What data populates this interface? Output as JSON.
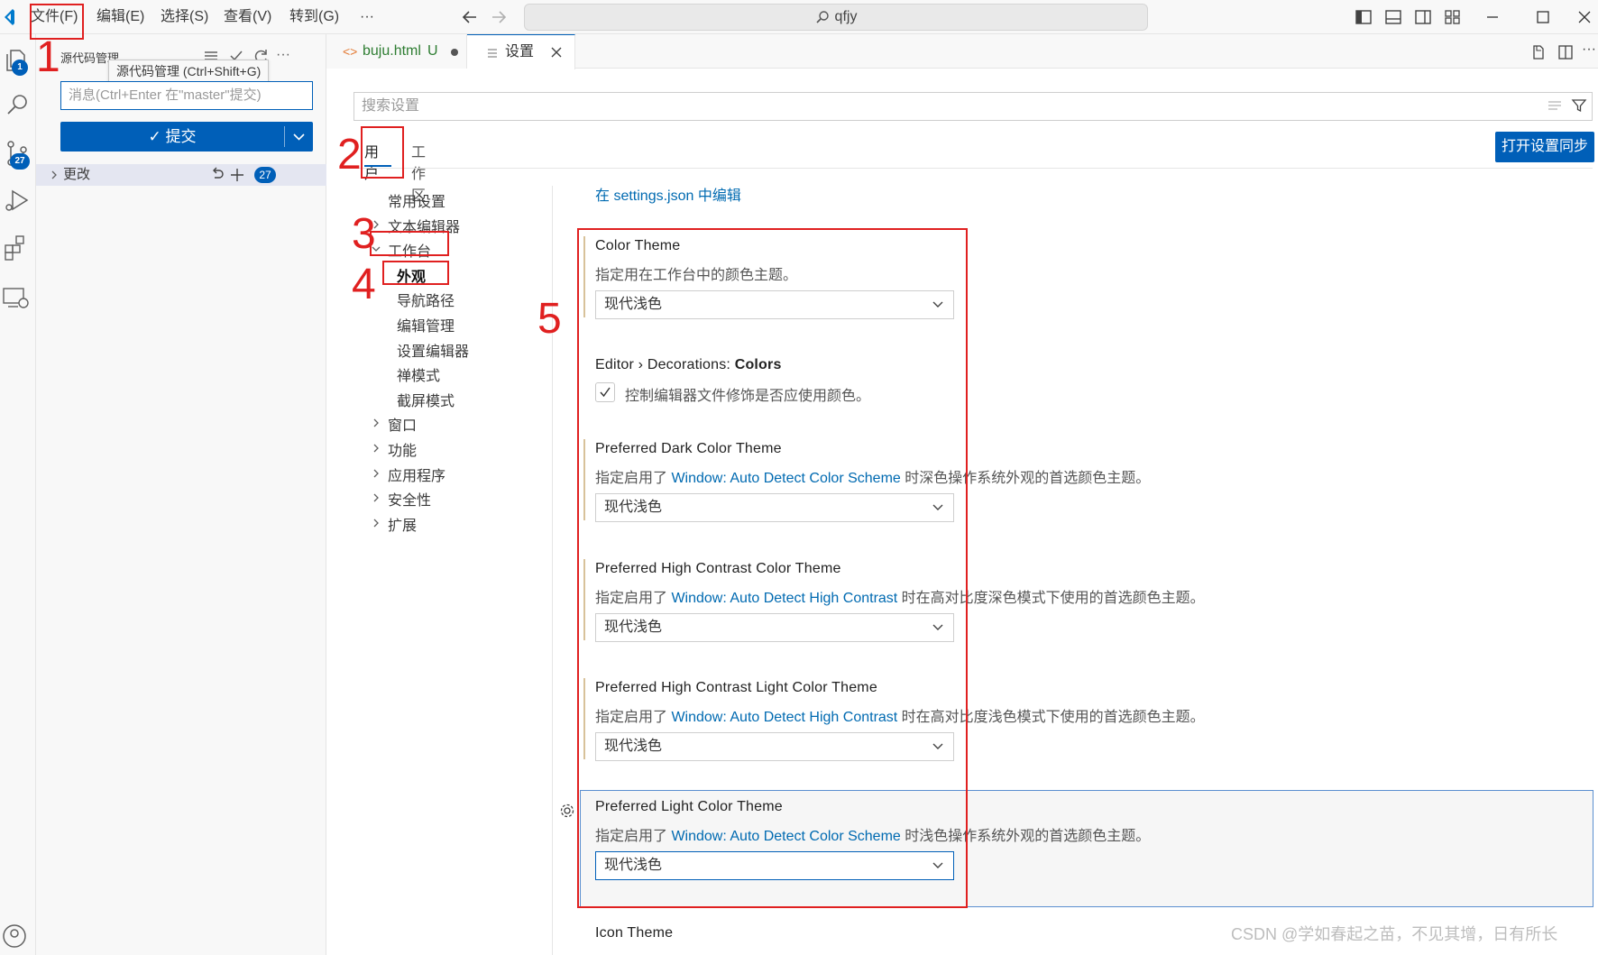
{
  "titlebar": {
    "menus": [
      "文件(F)",
      "编辑(E)",
      "选择(S)",
      "查看(V)",
      "转到(G)",
      "···"
    ],
    "command_center": "qfjy"
  },
  "activity": {
    "explorer_badge": "1",
    "scm_badge": "27"
  },
  "sidebar": {
    "title": "源代码管理",
    "tooltip": "源代码管理 (Ctrl+Shift+G)",
    "commit_placeholder": "消息(Ctrl+Enter 在\"master\"提交)",
    "commit_label": "✓ 提交",
    "changes_label": "更改",
    "changes_count": "27"
  },
  "tabs": [
    {
      "label": "buju.html",
      "status": "U"
    },
    {
      "label": "设置"
    }
  ],
  "settings": {
    "search_placeholder": "搜索设置",
    "scope_user": "用户",
    "scope_workspace": "工作区",
    "sync_button": "打开设置同步",
    "json_link": "在 settings.json 中编辑",
    "toc": [
      {
        "label": "常用设置",
        "level": 0,
        "chevron": "none"
      },
      {
        "label": "文本编辑器",
        "level": 0,
        "chevron": "right"
      },
      {
        "label": "工作台",
        "level": 0,
        "chevron": "down"
      },
      {
        "label": "外观",
        "level": 1,
        "chevron": "none",
        "selected": true
      },
      {
        "label": "导航路径",
        "level": 1,
        "chevron": "none"
      },
      {
        "label": "编辑管理",
        "level": 1,
        "chevron": "none"
      },
      {
        "label": "设置编辑器",
        "level": 1,
        "chevron": "none"
      },
      {
        "label": "禅模式",
        "level": 1,
        "chevron": "none"
      },
      {
        "label": "截屏模式",
        "level": 1,
        "chevron": "none"
      },
      {
        "label": "窗口",
        "level": 0,
        "chevron": "right"
      },
      {
        "label": "功能",
        "level": 0,
        "chevron": "right"
      },
      {
        "label": "应用程序",
        "level": 0,
        "chevron": "right"
      },
      {
        "label": "安全性",
        "level": 0,
        "chevron": "right"
      },
      {
        "label": "扩展",
        "level": 0,
        "chevron": "right"
      }
    ],
    "items": {
      "color_theme": {
        "title": "Color Theme",
        "desc": "指定用在工作台中的颜色主题。",
        "value": "现代浅色"
      },
      "decorations": {
        "title_prefix": "Editor › Decorations: ",
        "title_bold": "Colors",
        "desc": "控制编辑器文件修饰是否应使用颜色。",
        "checked": true
      },
      "dark": {
        "title": "Preferred Dark Color Theme",
        "desc_pre": "指定启用了 ",
        "desc_link": "Window: Auto Detect Color Scheme",
        "desc_post": " 时深色操作系统外观的首选颜色主题。",
        "value": "现代浅色"
      },
      "hc_dark": {
        "title": "Preferred High Contrast Color Theme",
        "desc_pre": "指定启用了 ",
        "desc_link": "Window: Auto Detect High Contrast",
        "desc_post": " 时在高对比度深色模式下使用的首选颜色主题。",
        "value": "现代浅色"
      },
      "hc_light": {
        "title": "Preferred High Contrast Light Color Theme",
        "desc_pre": "指定启用了 ",
        "desc_link": "Window: Auto Detect High Contrast",
        "desc_post": " 时在高对比度浅色模式下使用的首选颜色主题。",
        "value": "现代浅色"
      },
      "light": {
        "title": "Preferred Light Color Theme",
        "desc_pre": "指定启用了 ",
        "desc_link": "Window: Auto Detect Color Scheme",
        "desc_post": " 时浅色操作系统外观的首选颜色主题。",
        "value": "现代浅色"
      },
      "icon": {
        "title": "Icon Theme"
      }
    }
  },
  "annotations": [
    "1",
    "2",
    "3",
    "4",
    "5"
  ],
  "watermark": "CSDN @学如春起之苗，不见其增，日有所长",
  "colors": {
    "accent": "#005fb8",
    "annotation": "#e02020",
    "link": "#006ab1"
  }
}
